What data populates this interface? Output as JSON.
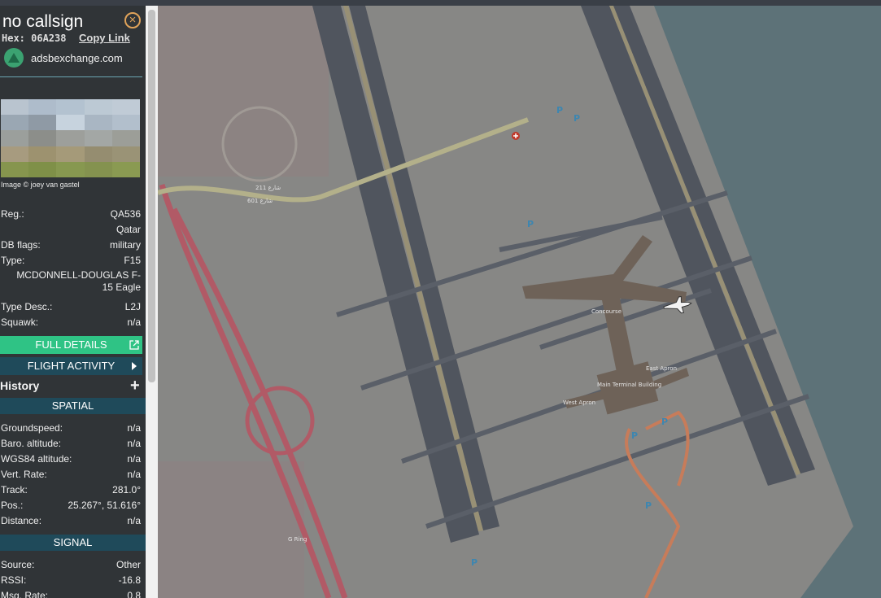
{
  "header": {
    "callsign": "no callsign",
    "hex_label": "Hex: 06A238",
    "copy_link": "Copy Link",
    "source_site": "adsbexchange.com"
  },
  "photo": {
    "credit": "Image © joey van gastel"
  },
  "details": {
    "reg_label": "Reg.:",
    "reg_value": "QA536",
    "country": "Qatar",
    "db_flags_label": "DB flags:",
    "db_flags_value": "military",
    "type_label": "Type:",
    "type_value": "F15",
    "type_full_line1": "MCDONNELL-DOUGLAS F-",
    "type_full_line2": "15 Eagle",
    "type_desc_label": "Type Desc.:",
    "type_desc_value": "L2J",
    "squawk_label": "Squawk:",
    "squawk_value": "n/a"
  },
  "buttons": {
    "full_details": "FULL DETAILS",
    "flight_activity": "FLIGHT ACTIVITY",
    "history": "History"
  },
  "spatial": {
    "title": "SPATIAL",
    "groundspeed_label": "Groundspeed:",
    "groundspeed_value": "n/a",
    "baro_label": "Baro. altitude:",
    "baro_value": "n/a",
    "wgs_label": "WGS84 altitude:",
    "wgs_value": "n/a",
    "vert_label": "Vert. Rate:",
    "vert_value": "n/a",
    "track_label": "Track:",
    "track_value": "281.0°",
    "pos_label": "Pos.:",
    "pos_value": "25.267°, 51.616°",
    "distance_label": "Distance:",
    "distance_value": "n/a"
  },
  "signal": {
    "title": "SIGNAL",
    "source_label": "Source:",
    "source_value": "Other",
    "rssi_label": "RSSI:",
    "rssi_value": "-16.8",
    "msg_rate_label": "Msg. Rate:",
    "msg_rate_value": "0.8"
  },
  "map": {
    "labels": {
      "concourse": "Concourse",
      "east_apron": "East Apron",
      "west_apron": "West Apron",
      "main_terminal": "Main Terminal Building",
      "g_ring": "G Ring",
      "street_211": "شارع 211",
      "street_601": "شارع 601"
    }
  },
  "colors": {
    "sidebar_bg": "#303437",
    "section_bg": "#1f4a5a",
    "full_details_bg": "#2fc385",
    "sea": "#5d7278",
    "land": "#878785",
    "runway": "#515660",
    "road_red": "#b25c66"
  }
}
